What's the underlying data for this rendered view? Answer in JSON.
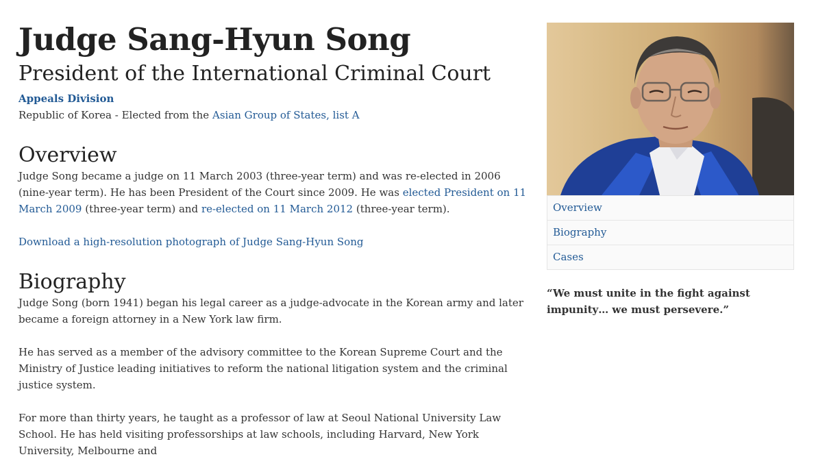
{
  "header": {
    "title": "Judge Sang-Hyun Song",
    "subtitle": "President of the International Criminal Court",
    "division": "Appeals Division",
    "origin_prefix": "Republic of Korea - Elected from the",
    "origin_link": "Asian Group of States, list A"
  },
  "overview": {
    "heading": "Overview",
    "text_1": "Judge Song became a judge on 11 March 2003 (three-year term) and was re-elected in 2006 (nine-year term). He has been President of the Court since 2009. He was",
    "link_1": "elected President on 11 March 2009",
    "text_2": "(three-year term) and",
    "link_2": "re-elected on 11 March 2012",
    "text_3": "(three-year term).",
    "download_link": "Download a high-resolution photograph of Judge Sang-Hyun Song"
  },
  "biography": {
    "heading": "Biography",
    "paragraphs": [
      "Judge Song (born 1941) began his legal career as a judge-advocate in the Korean army and later became a foreign attorney in a New York law firm.",
      "He has served as a member of the advisory committee to the Korean Supreme Court and the Ministry of Justice leading initiatives to reform the national litigation system and the criminal justice system.",
      "For more than thirty years, he taught as a professor of law at Seoul National University Law School. He has held visiting professorships at law schools, including Harvard, New York University, Melbourne and"
    ]
  },
  "sidebar": {
    "nav": [
      {
        "label": "Overview"
      },
      {
        "label": "Biography"
      },
      {
        "label": "Cases"
      }
    ],
    "quote": "“We must unite in the fight against impunity… we must persevere.”"
  }
}
